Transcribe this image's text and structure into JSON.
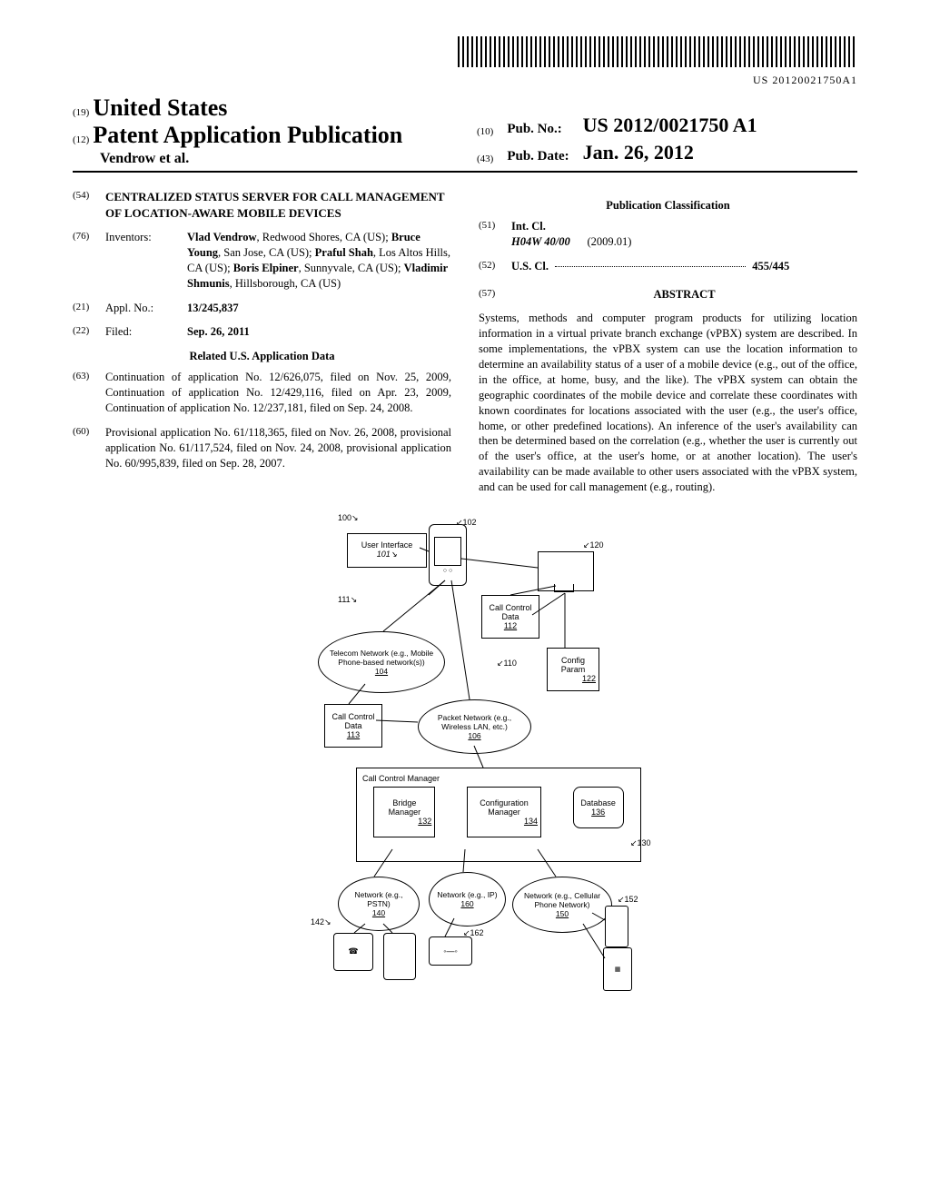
{
  "barcode_num": "US 20120021750A1",
  "header": {
    "code19": "(19)",
    "country": "United States",
    "code12": "(12)",
    "pub_type": "Patent Application Publication",
    "authors": "Vendrow et al.",
    "code10": "(10)",
    "pubnum_label": "Pub. No.:",
    "pubnum": "US 2012/0021750 A1",
    "code43": "(43)",
    "pubdate_label": "Pub. Date:",
    "pubdate": "Jan. 26, 2012"
  },
  "left": {
    "title_code": "(54)",
    "title": "CENTRALIZED STATUS SERVER FOR CALL MANAGEMENT OF LOCATION-AWARE MOBILE DEVICES",
    "inventors_code": "(76)",
    "inventors_label": "Inventors:",
    "inventors_html": "<b>Vlad Vendrow</b>, Redwood Shores, CA (US); <b>Bruce Young</b>, San Jose, CA (US); <b>Praful Shah</b>, Los Altos Hills, CA (US); <b>Boris Elpiner</b>, Sunnyvale, CA (US); <b>Vladimir Shmunis</b>, Hillsborough, CA (US)",
    "applno_code": "(21)",
    "applno_label": "Appl. No.:",
    "applno": "13/245,837",
    "filed_code": "(22)",
    "filed_label": "Filed:",
    "filed": "Sep. 26, 2011",
    "related_heading": "Related U.S. Application Data",
    "cont_code": "(63)",
    "cont": "Continuation of application No. 12/626,075, filed on Nov. 25, 2009, Continuation of application No. 12/429,116, filed on Apr. 23, 2009, Continuation of application No. 12/237,181, filed on Sep. 24, 2008.",
    "prov_code": "(60)",
    "prov": "Provisional application No. 61/118,365, filed on Nov. 26, 2008, provisional application No. 61/117,524, filed on Nov. 24, 2008, provisional application No. 60/995,839, filed on Sep. 28, 2007."
  },
  "right": {
    "class_heading": "Publication Classification",
    "intcl_code": "(51)",
    "intcl_label": "Int. Cl.",
    "intcl_sym": "H04W 40/00",
    "intcl_date": "(2009.01)",
    "uscl_code": "(52)",
    "uscl_label": "U.S. Cl.",
    "uscl_val": "455/445",
    "abstract_code": "(57)",
    "abstract_label": "ABSTRACT",
    "abstract": "Systems, methods and computer program products for utilizing location information in a virtual private branch exchange (vPBX) system are described. In some implementations, the vPBX system can use the location information to determine an availability status of a user of a mobile device (e.g., out of the office, in the office, at home, busy, and the like). The vPBX system can obtain the geographic coordinates of the mobile device and correlate these coordinates with known coordinates for locations associated with the user (e.g., the user's office, home, or other predefined locations). An inference of the user's availability can then be determined based on the correlation (e.g., whether the user is currently out of the user's office, at the user's home, or at another location). The user's availability can be made available to other users associated with the vPBX system, and can be used for call management (e.g., routing)."
  },
  "figure": {
    "n100": "100",
    "n102": "102",
    "n101": "101",
    "ui": "User Interface",
    "n111": "111",
    "n120": "120",
    "ccd112": "Call Control Data",
    "n112": "112",
    "telecom": "Telecom Network (e.g., Mobile Phone-based network(s))",
    "n104": "104",
    "n110": "110",
    "config": "Config Param",
    "n122": "122",
    "ccd113": "Call Control Data",
    "n113": "113",
    "packet": "Packet Network (e.g., Wireless LAN, etc.)",
    "n106": "106",
    "ccm": "Call Control Manager",
    "bridge": "Bridge Manager",
    "n132": "132",
    "cfgmgr": "Configuration Manager",
    "n134": "134",
    "db": "Database",
    "n136": "136",
    "n130": "130",
    "pstn": "Network (e.g., PSTN)",
    "n140": "140",
    "ip": "Network (e.g., IP)",
    "n160": "160",
    "cell": "Network (e.g., Cellular Phone Network)",
    "n150": "150",
    "n142": "142",
    "n152": "152",
    "n162": "162"
  }
}
